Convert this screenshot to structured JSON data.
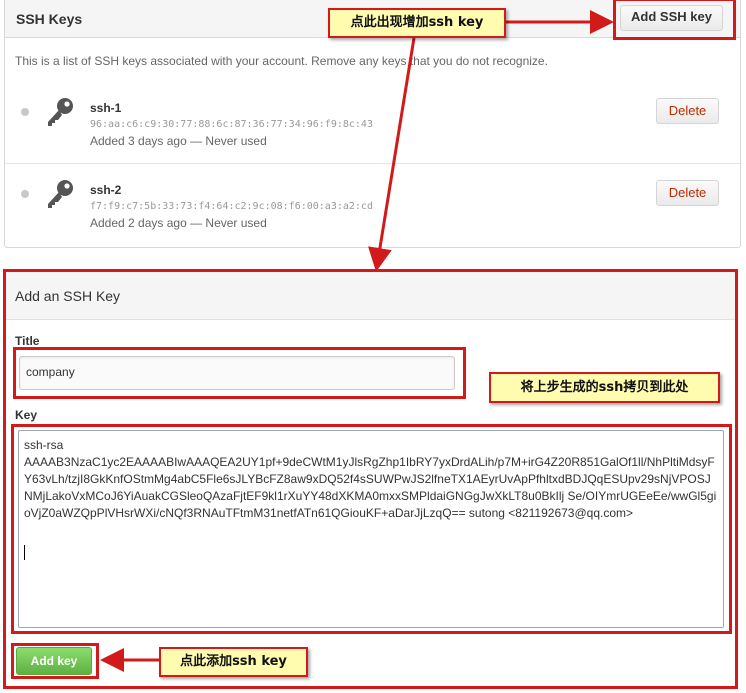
{
  "ssh_keys": {
    "title": "SSH Keys",
    "add_button": "Add SSH key",
    "description": "This is a list of SSH keys associated with your account. Remove any keys that you do not recognize.",
    "delete_label": "Delete",
    "keys": [
      {
        "name": "ssh-1",
        "fingerprint": "96:aa:c6:c9:30:77:88:6c:87:36:77:34:96:f9:8c:43",
        "meta": "Added 3 days ago — Never used"
      },
      {
        "name": "ssh-2",
        "fingerprint": "f7:f9:c7:5b:33:73:f4:64:c2:9c:08:f6:00:a3:a2:cd",
        "meta": "Added 2 days ago — Never used"
      }
    ]
  },
  "add_form": {
    "title": "Add an SSH Key",
    "title_label": "Title",
    "title_value": "company",
    "key_label": "Key",
    "key_value": "ssh-rsa\nAAAAB3NzaC1yc2EAAAABIwAAAQEA2UY1pf+9deCWtM1yJlsRgZhp1IbRY7yxDrdALih/p7M+irG4Z20R851GalOf1ll/NhPltiMdsyFY63vLh/tzjI8GkKnfOStmMg4abC5Fle6sJLYBcFZ8aw9xDQ52f4sSUWPwJS2lfneTX1AEyrUvApPfhltxdBDJQqESUpv29sNjVPOSJNMjLakoVxMCoJ6YiAuakCGSleoQAzaFjtEF9kl1rXuYY48dXKMA0mxxSMPldaiGNGgJwXkLT8u0BkIlj Se/OIYmrUGEeEe/wwGl5gioVjZ0aWZQpPlVHsrWXi/cNQf3RNAuTFtmM31netfATn61QGiouKF+aDarJjLzqQ== sutong <821192673@qq.com>",
    "submit_label": "Add key"
  },
  "annotations": {
    "top_callout": "点此出现增加ssh key",
    "key_callout": "将上步生成的ssh拷贝到此处",
    "bottom_callout": "点此添加ssh key"
  },
  "colors": {
    "annotation_red": "#d31a1a",
    "callout_bg": "#fffcb0",
    "delete_red": "#bd2c00",
    "button_green": "#60b044"
  }
}
